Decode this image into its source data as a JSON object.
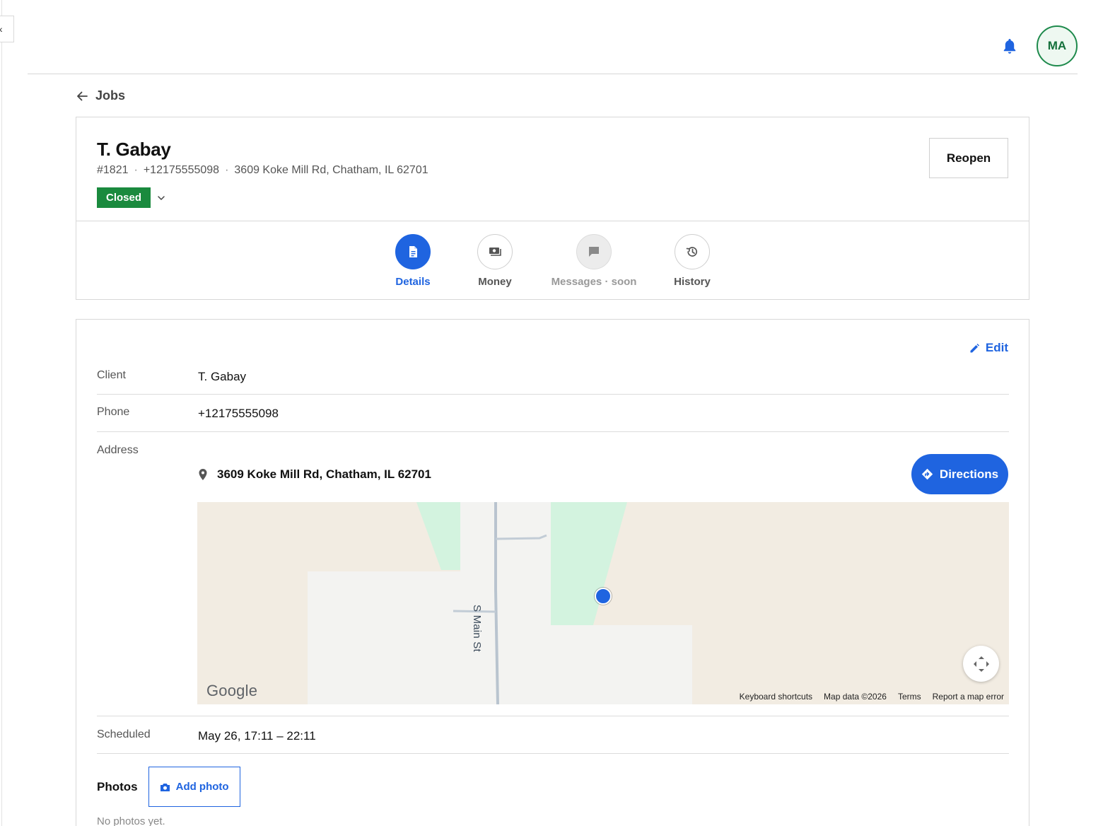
{
  "header": {
    "collapse_glyph": "‹",
    "avatar_initials": "MA",
    "bell_icon": "bell-icon"
  },
  "breadcrumb": {
    "back_label": "Jobs"
  },
  "job": {
    "title": "T. Gabay",
    "number": "#1821",
    "phone": "+12175555098",
    "address": "3609 Koke Mill Rd, Chatham, IL 62701",
    "meta_separator": "·",
    "status": "Closed",
    "status_color": "#1a8a3e",
    "reopen_label": "Reopen"
  },
  "tabs": [
    {
      "label": "Details",
      "icon": "document-icon",
      "state": "active"
    },
    {
      "label": "Money",
      "icon": "money-icon",
      "state": "normal"
    },
    {
      "label": "Messages · soon",
      "icon": "chat-icon",
      "state": "disabled"
    },
    {
      "label": "History",
      "icon": "history-icon",
      "state": "normal"
    }
  ],
  "details": {
    "edit_label": "Edit",
    "client_label": "Client",
    "client_value": "T. Gabay",
    "phone_label": "Phone",
    "phone_value": "+12175555098",
    "address_label": "Address",
    "address_value": "3609 Koke Mill Rd, Chatham, IL 62701",
    "directions_label": "Directions",
    "scheduled_label": "Scheduled",
    "scheduled_value": "May 26, 17:11 – 22:11",
    "photos_label": "Photos",
    "add_photo_label": "Add photo",
    "no_photos": "No photos yet."
  },
  "map": {
    "street_label": "S Main St",
    "logo": "Google",
    "attribution": [
      "Keyboard shortcuts",
      "Map data ©2026",
      "Terms",
      "Report a map error"
    ]
  },
  "colors": {
    "accent": "#1f64e0",
    "success": "#1a8a3e",
    "avatar_border": "#1e8a4c"
  }
}
